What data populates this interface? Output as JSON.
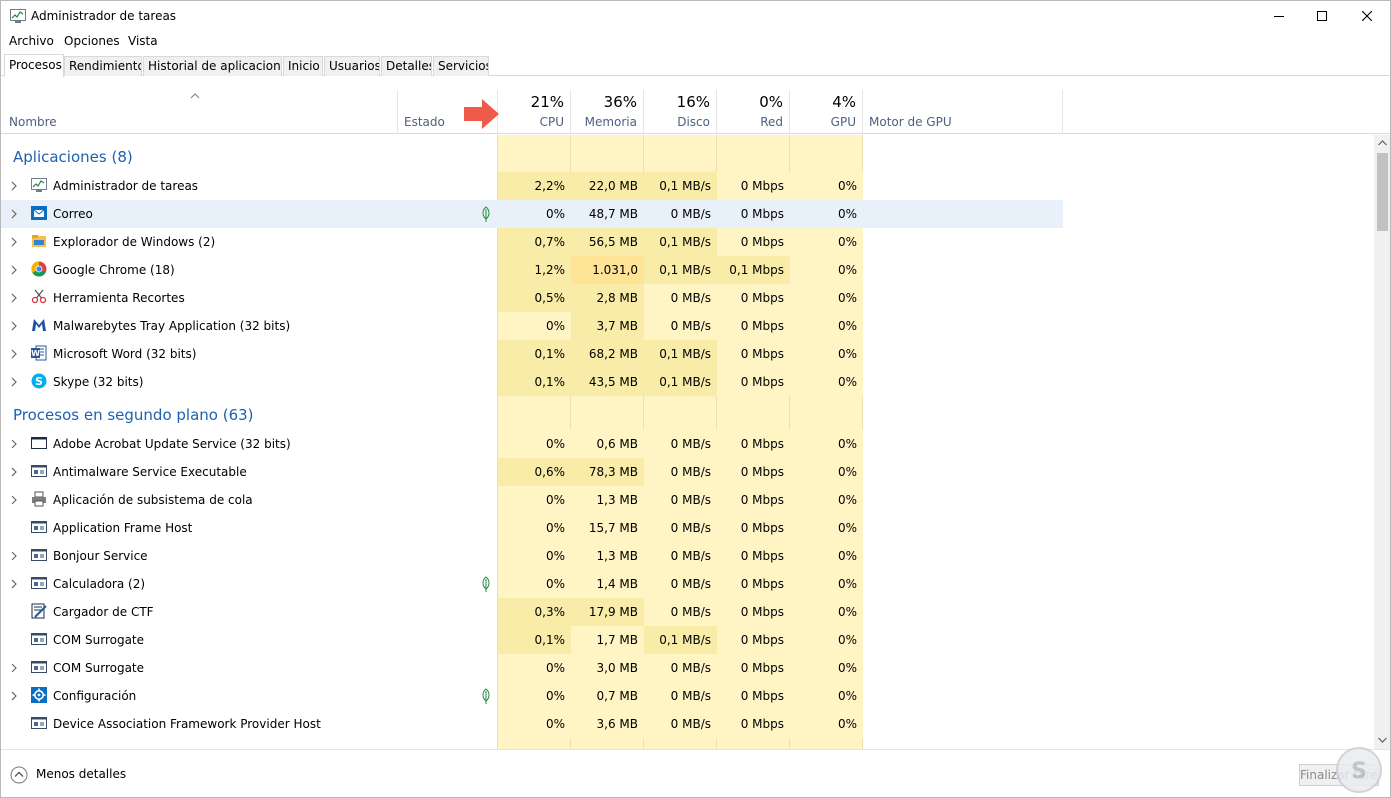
{
  "window": {
    "title": "Administrador de tareas"
  },
  "menu": [
    "Archivo",
    "Opciones",
    "Vista"
  ],
  "tabs": [
    "Procesos",
    "Rendimiento",
    "Historial de aplicaciones",
    "Inicio",
    "Usuarios",
    "Detalles",
    "Servicios"
  ],
  "active_tab": "Procesos",
  "columns": {
    "name": "Nombre",
    "status": "Estado",
    "cpu": {
      "label": "CPU",
      "pct": "21%"
    },
    "memory": {
      "label": "Memoria",
      "pct": "36%"
    },
    "disk": {
      "label": "Disco",
      "pct": "16%"
    },
    "network": {
      "label": "Red",
      "pct": "0%"
    },
    "gpu": {
      "label": "GPU",
      "pct": "4%"
    },
    "gpu_engine": "Motor de GPU"
  },
  "groups": [
    {
      "title": "Aplicaciones (8)",
      "rows": [
        {
          "name": "Administrador de tareas",
          "icon": "task-manager-icon",
          "expand": true,
          "leaf": false,
          "selected": false,
          "cpu": "2,2%",
          "mem": "22,0 MB",
          "disk": "0,1 MB/s",
          "net": "0 Mbps",
          "gpu": "0%",
          "heat": [
            2,
            2,
            2,
            1,
            1
          ]
        },
        {
          "name": "Correo",
          "icon": "mail-icon",
          "expand": true,
          "leaf": true,
          "selected": true,
          "cpu": "0%",
          "mem": "48,7 MB",
          "disk": "0 MB/s",
          "net": "0 Mbps",
          "gpu": "0%",
          "heat": [
            0,
            0,
            0,
            0,
            0
          ]
        },
        {
          "name": "Explorador de Windows (2)",
          "icon": "folder-icon",
          "expand": true,
          "leaf": false,
          "selected": false,
          "cpu": "0,7%",
          "mem": "56,5 MB",
          "disk": "0,1 MB/s",
          "net": "0 Mbps",
          "gpu": "0%",
          "heat": [
            2,
            2,
            2,
            1,
            1
          ]
        },
        {
          "name": "Google Chrome (18)",
          "icon": "chrome-icon",
          "expand": true,
          "leaf": false,
          "selected": false,
          "cpu": "1,2%",
          "mem": "1.031,0 MB",
          "disk": "0,1 MB/s",
          "net": "0,1 Mbps",
          "gpu": "0%",
          "heat": [
            2,
            3,
            2,
            2,
            1
          ]
        },
        {
          "name": "Herramienta Recortes",
          "icon": "scissors-icon",
          "expand": true,
          "leaf": false,
          "selected": false,
          "cpu": "0,5%",
          "mem": "2,8 MB",
          "disk": "0 MB/s",
          "net": "0 Mbps",
          "gpu": "0%",
          "heat": [
            2,
            2,
            1,
            1,
            1
          ]
        },
        {
          "name": "Malwarebytes Tray Application (32 bits)",
          "icon": "malwarebytes-icon",
          "expand": true,
          "leaf": false,
          "selected": false,
          "cpu": "0%",
          "mem": "3,7 MB",
          "disk": "0 MB/s",
          "net": "0 Mbps",
          "gpu": "0%",
          "heat": [
            1,
            2,
            1,
            1,
            1
          ]
        },
        {
          "name": "Microsoft Word (32 bits)",
          "icon": "word-icon",
          "expand": true,
          "leaf": false,
          "selected": false,
          "cpu": "0,1%",
          "mem": "68,2 MB",
          "disk": "0,1 MB/s",
          "net": "0 Mbps",
          "gpu": "0%",
          "heat": [
            2,
            2,
            2,
            1,
            1
          ]
        },
        {
          "name": "Skype (32 bits)",
          "icon": "skype-icon",
          "expand": true,
          "leaf": false,
          "selected": false,
          "cpu": "0,1%",
          "mem": "43,5 MB",
          "disk": "0,1 MB/s",
          "net": "0 Mbps",
          "gpu": "0%",
          "heat": [
            2,
            2,
            2,
            1,
            1
          ]
        }
      ]
    },
    {
      "title": "Procesos en segundo plano (63)",
      "rows": [
        {
          "name": "Adobe Acrobat Update Service (32 bits)",
          "icon": "window-icon",
          "expand": true,
          "leaf": false,
          "selected": false,
          "cpu": "0%",
          "mem": "0,6 MB",
          "disk": "0 MB/s",
          "net": "0 Mbps",
          "gpu": "0%",
          "heat": [
            1,
            1,
            1,
            1,
            1
          ]
        },
        {
          "name": "Antimalware Service Executable",
          "icon": "service-icon",
          "expand": true,
          "leaf": false,
          "selected": false,
          "cpu": "0,6%",
          "mem": "78,3 MB",
          "disk": "0 MB/s",
          "net": "0 Mbps",
          "gpu": "0%",
          "heat": [
            2,
            2,
            1,
            1,
            1
          ]
        },
        {
          "name": "Aplicación de subsistema de cola",
          "icon": "printer-icon",
          "expand": true,
          "leaf": false,
          "selected": false,
          "cpu": "0%",
          "mem": "1,3 MB",
          "disk": "0 MB/s",
          "net": "0 Mbps",
          "gpu": "0%",
          "heat": [
            1,
            1,
            1,
            1,
            1
          ]
        },
        {
          "name": "Application Frame Host",
          "icon": "service-icon",
          "expand": false,
          "leaf": false,
          "selected": false,
          "cpu": "0%",
          "mem": "15,7 MB",
          "disk": "0 MB/s",
          "net": "0 Mbps",
          "gpu": "0%",
          "heat": [
            1,
            1,
            1,
            1,
            1
          ]
        },
        {
          "name": "Bonjour Service",
          "icon": "service-icon",
          "expand": true,
          "leaf": false,
          "selected": false,
          "cpu": "0%",
          "mem": "1,3 MB",
          "disk": "0 MB/s",
          "net": "0 Mbps",
          "gpu": "0%",
          "heat": [
            1,
            1,
            1,
            1,
            1
          ]
        },
        {
          "name": "Calculadora (2)",
          "icon": "service-icon",
          "expand": true,
          "leaf": true,
          "selected": false,
          "cpu": "0%",
          "mem": "1,4 MB",
          "disk": "0 MB/s",
          "net": "0 Mbps",
          "gpu": "0%",
          "heat": [
            1,
            1,
            1,
            1,
            1
          ]
        },
        {
          "name": "Cargador de CTF",
          "icon": "ctf-icon",
          "expand": false,
          "leaf": false,
          "selected": false,
          "cpu": "0,3%",
          "mem": "17,9 MB",
          "disk": "0 MB/s",
          "net": "0 Mbps",
          "gpu": "0%",
          "heat": [
            2,
            2,
            1,
            1,
            1
          ]
        },
        {
          "name": "COM Surrogate",
          "icon": "service-icon",
          "expand": false,
          "leaf": false,
          "selected": false,
          "cpu": "0,1%",
          "mem": "1,7 MB",
          "disk": "0,1 MB/s",
          "net": "0 Mbps",
          "gpu": "0%",
          "heat": [
            2,
            1,
            2,
            1,
            1
          ]
        },
        {
          "name": "COM Surrogate",
          "icon": "service-icon",
          "expand": true,
          "leaf": false,
          "selected": false,
          "cpu": "0%",
          "mem": "3,0 MB",
          "disk": "0 MB/s",
          "net": "0 Mbps",
          "gpu": "0%",
          "heat": [
            1,
            1,
            1,
            1,
            1
          ]
        },
        {
          "name": "Configuración",
          "icon": "gear-icon",
          "expand": true,
          "leaf": true,
          "selected": false,
          "cpu": "0%",
          "mem": "0,7 MB",
          "disk": "0 MB/s",
          "net": "0 Mbps",
          "gpu": "0%",
          "heat": [
            1,
            1,
            1,
            1,
            1
          ]
        },
        {
          "name": "Device Association Framework Provider Host",
          "icon": "service-icon",
          "expand": false,
          "leaf": false,
          "selected": false,
          "cpu": "0%",
          "mem": "3,6 MB",
          "disk": "0 MB/s",
          "net": "0 Mbps",
          "gpu": "0%",
          "heat": [
            1,
            1,
            1,
            1,
            1
          ]
        }
      ]
    }
  ],
  "footer": {
    "less_details": "Menos detalles",
    "end_task": "Finalizar tarea"
  },
  "colors": {
    "accent": "#1e61b0",
    "heat_low": "#fff4c4",
    "heat_mid": "#f9eca8",
    "heat_high": "#ffe396",
    "selected": "#e8f1f9",
    "arrow": "#f05a4a"
  }
}
